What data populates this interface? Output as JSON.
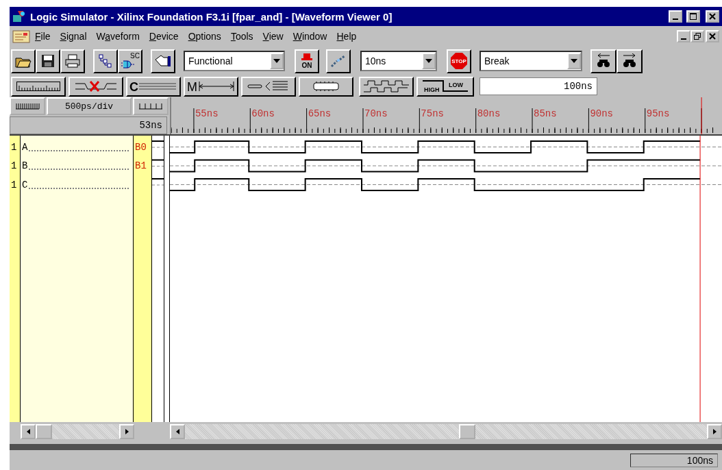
{
  "window": {
    "title": "Logic Simulator - Xilinx Foundation F3.1i [fpar_and] - [Waveform Viewer 0]"
  },
  "menu": [
    {
      "access_key": "F",
      "rest": "ile"
    },
    {
      "access_key": "S",
      "rest": "ignal"
    },
    {
      "before": "W",
      "access_key": "a",
      "rest": "veform"
    },
    {
      "access_key": "D",
      "rest": "evice"
    },
    {
      "access_key": "O",
      "rest": "ptions"
    },
    {
      "access_key": "T",
      "rest": "ools"
    },
    {
      "access_key": "V",
      "rest": "iew"
    },
    {
      "access_key": "W",
      "rest": "indow"
    },
    {
      "access_key": "H",
      "rest": "elp"
    }
  ],
  "toolbar": {
    "sc_label": "SC",
    "mode_combo": "Functional",
    "on_label": "ON",
    "step_combo": "10ns",
    "stop_label": "STOP",
    "break_combo": "Break"
  },
  "toolbar2": {
    "c_label": "C",
    "m_label": "M",
    "high_label": "HIGH",
    "low_label": "LOW",
    "time_field": "100ns"
  },
  "ruler": {
    "scale": "500ps/div",
    "offset": "53ns",
    "labels": [
      "55ns",
      "60ns",
      "65ns",
      "70ns",
      "75ns",
      "80ns",
      "85ns",
      "90ns",
      "95ns"
    ]
  },
  "signals": [
    {
      "number": "1",
      "name": "A",
      "value": "B0"
    },
    {
      "number": "1",
      "name": "B",
      "value": "B1"
    },
    {
      "number": "1",
      "name": "C"
    }
  ],
  "status_bar": {
    "time": "100ns"
  }
}
